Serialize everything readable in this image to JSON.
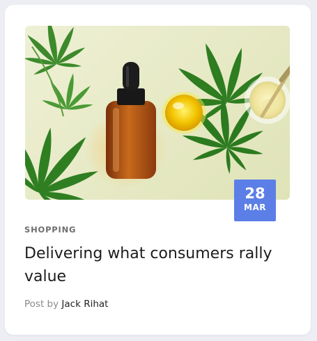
{
  "post": {
    "category": "SHOPPING",
    "title": "Delivering what consumers rally value",
    "date": {
      "day": "28",
      "month": "MAR"
    },
    "byline_prefix": "Post by",
    "author": "Jack Rihat"
  },
  "colors": {
    "badge": "#5b7fe6",
    "card": "#ffffff",
    "page_background": "#eceef4"
  },
  "image": {
    "icons": [
      "cannabis-leaf-icon",
      "dropper-bottle-icon",
      "oil-dish-icon"
    ]
  }
}
